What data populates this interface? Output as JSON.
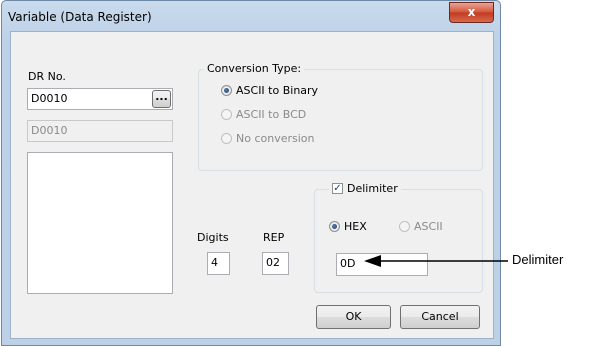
{
  "window": {
    "title": "Variable (Data Register)",
    "close_glyph": "x"
  },
  "dr": {
    "label": "DR No.",
    "value": "D0010",
    "browse_label": "...",
    "display_value": "D0010"
  },
  "conversion": {
    "title": "Conversion Type:",
    "options": [
      {
        "label": "ASCII to Binary",
        "selected": true,
        "enabled": true
      },
      {
        "label": "ASCII to BCD",
        "selected": false,
        "enabled": false
      },
      {
        "label": "No conversion",
        "selected": false,
        "enabled": false
      }
    ]
  },
  "digits": {
    "label": "Digits",
    "value": "4"
  },
  "rep": {
    "label": "REP",
    "value": "02"
  },
  "delimiter": {
    "label": "Delimiter",
    "checked": true,
    "hex_label": "HEX",
    "ascii_label": "ASCII",
    "value": "0D"
  },
  "buttons": {
    "ok": "OK",
    "cancel": "Cancel"
  },
  "callout": {
    "label": "Delimiter"
  }
}
